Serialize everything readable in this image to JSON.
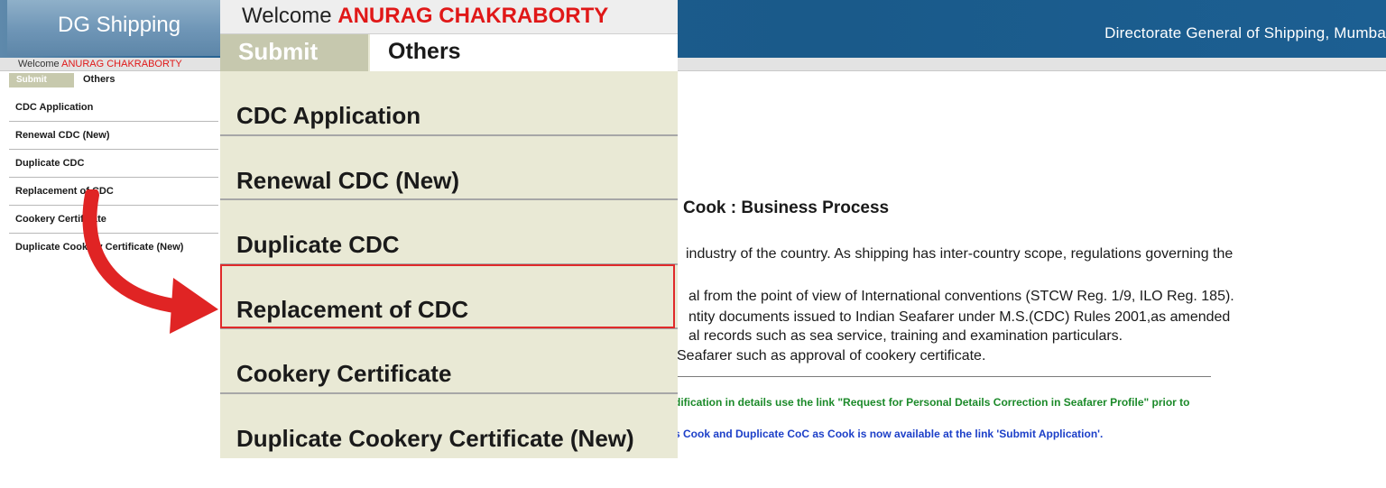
{
  "header": {
    "logo_text": "DG Shipping",
    "org_name": "Directorate General of Shipping, Mumba"
  },
  "welcome": {
    "label": "Welcome",
    "user": "ANURAG CHAKRABORTY"
  },
  "tabs": {
    "submit": "Submit",
    "others": "Others"
  },
  "menu": {
    "items": [
      {
        "label": "CDC Application"
      },
      {
        "label": "Renewal CDC (New)"
      },
      {
        "label": "Duplicate CDC"
      },
      {
        "label": "Replacement of CDC"
      },
      {
        "label": "Cookery Certificate"
      },
      {
        "label": "Duplicate Cookery Certificate (New)"
      }
    ],
    "highlighted_index": 3
  },
  "background_page": {
    "title": "Cook : Business Process",
    "lines": [
      "industry of the country. As shipping has inter-country scope, regulations governing the",
      "al from the point of view of International conventions (STCW Reg. 1/9, ILO Reg. 185).",
      "ntity documents issued to Indian Seafarer under M.S.(CDC) Rules 2001,as amended",
      "al records such as sea service, training and examination particulars.",
      "Seafarer such as approval of cookery certificate."
    ],
    "note_green": "dification in details use the link \"Request for Personal Details Correction in Seafarer Profile\" prior to",
    "note_blue": "s Cook and Duplicate CoC as Cook is now available at the link 'Submit Application'."
  },
  "colors": {
    "header_blue": "#1a5a8a",
    "user_red": "#e01818",
    "highlight_red": "#e02a2a",
    "menu_bg": "#e9e9d5",
    "note_green": "#1c8a2a",
    "note_blue": "#1c3fc8"
  },
  "icons": {
    "arrow": "curved-arrow-icon"
  }
}
